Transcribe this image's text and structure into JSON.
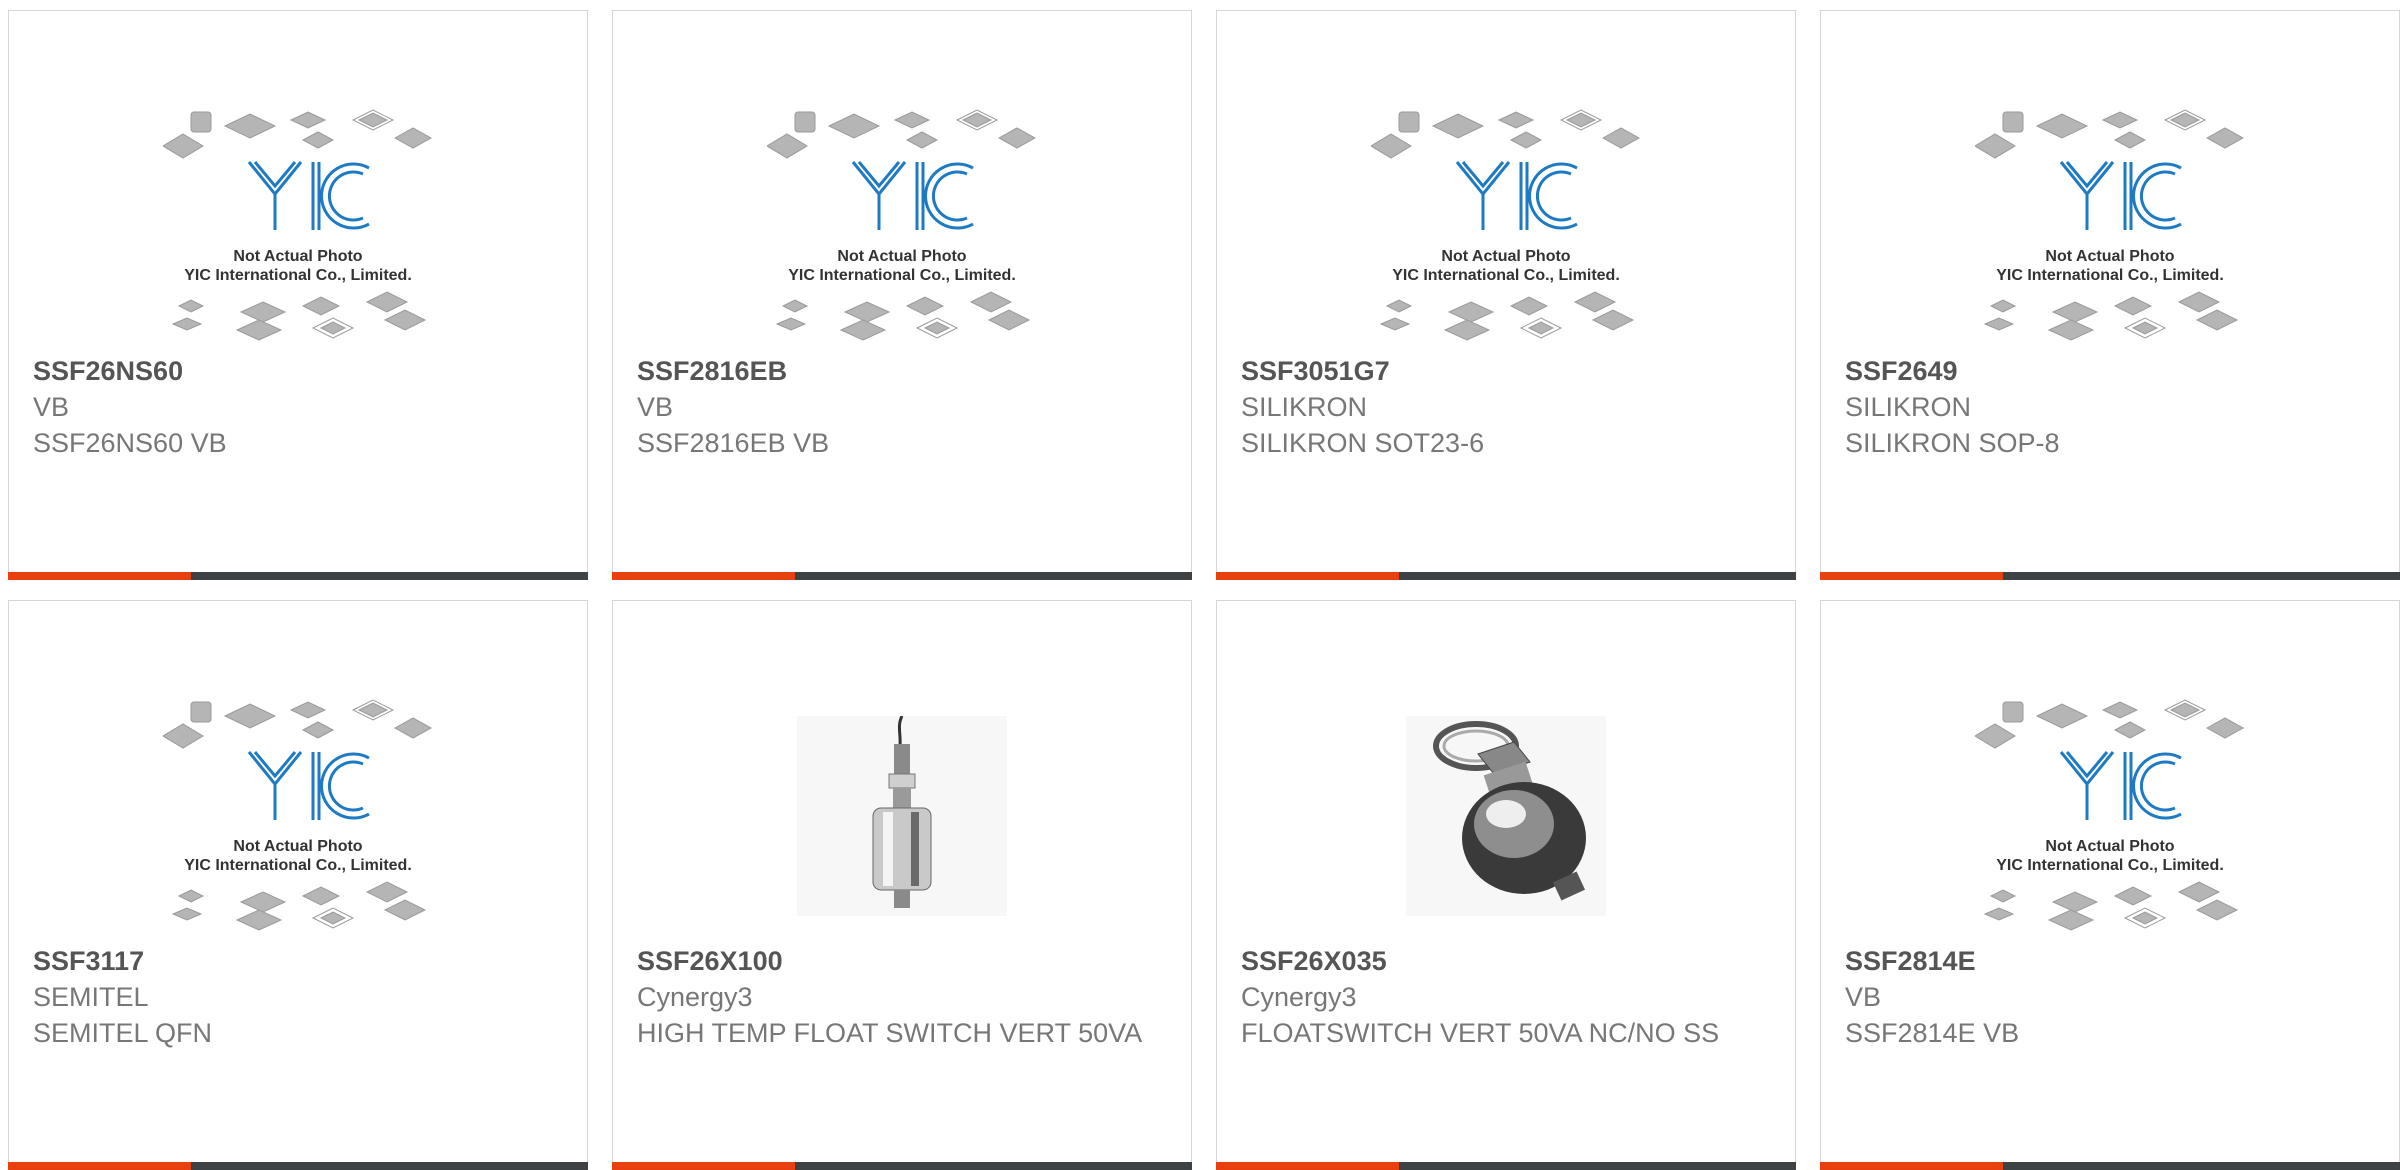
{
  "colors": {
    "accent": "#e8410f",
    "bar_dark": "#3f4245",
    "logo_blue": "#1f7ac4"
  },
  "placeholder": {
    "logo_text": "YIC",
    "line1": "Not Actual Photo",
    "line2": "YIC International Co., Limited."
  },
  "products": [
    {
      "part": "SSF26NS60",
      "manufacturer": "VB",
      "description": "SSF26NS60 VB",
      "image": "placeholder"
    },
    {
      "part": "SSF2816EB",
      "manufacturer": "VB",
      "description": "SSF2816EB VB",
      "image": "placeholder"
    },
    {
      "part": "SSF3051G7",
      "manufacturer": "SILIKRON",
      "description": "SILIKRON SOT23-6",
      "image": "placeholder"
    },
    {
      "part": "SSF2649",
      "manufacturer": "SILIKRON",
      "description": "SILIKRON SOP-8",
      "image": "placeholder"
    },
    {
      "part": "SSF3117",
      "manufacturer": "SEMITEL",
      "description": "SEMITEL QFN",
      "image": "placeholder"
    },
    {
      "part": "SSF26X100",
      "manufacturer": "Cynergy3",
      "description": "HIGH TEMP FLOAT SWITCH VERT 50VA",
      "image": "float-switch-icon"
    },
    {
      "part": "SSF26X035",
      "manufacturer": "Cynergy3",
      "description": "FLOATSWITCH VERT 50VA NC/NO SS",
      "image": "float-switch-ring-icon"
    },
    {
      "part": "SSF2814E",
      "manufacturer": "VB",
      "description": "SSF2814E VB",
      "image": "placeholder"
    }
  ]
}
